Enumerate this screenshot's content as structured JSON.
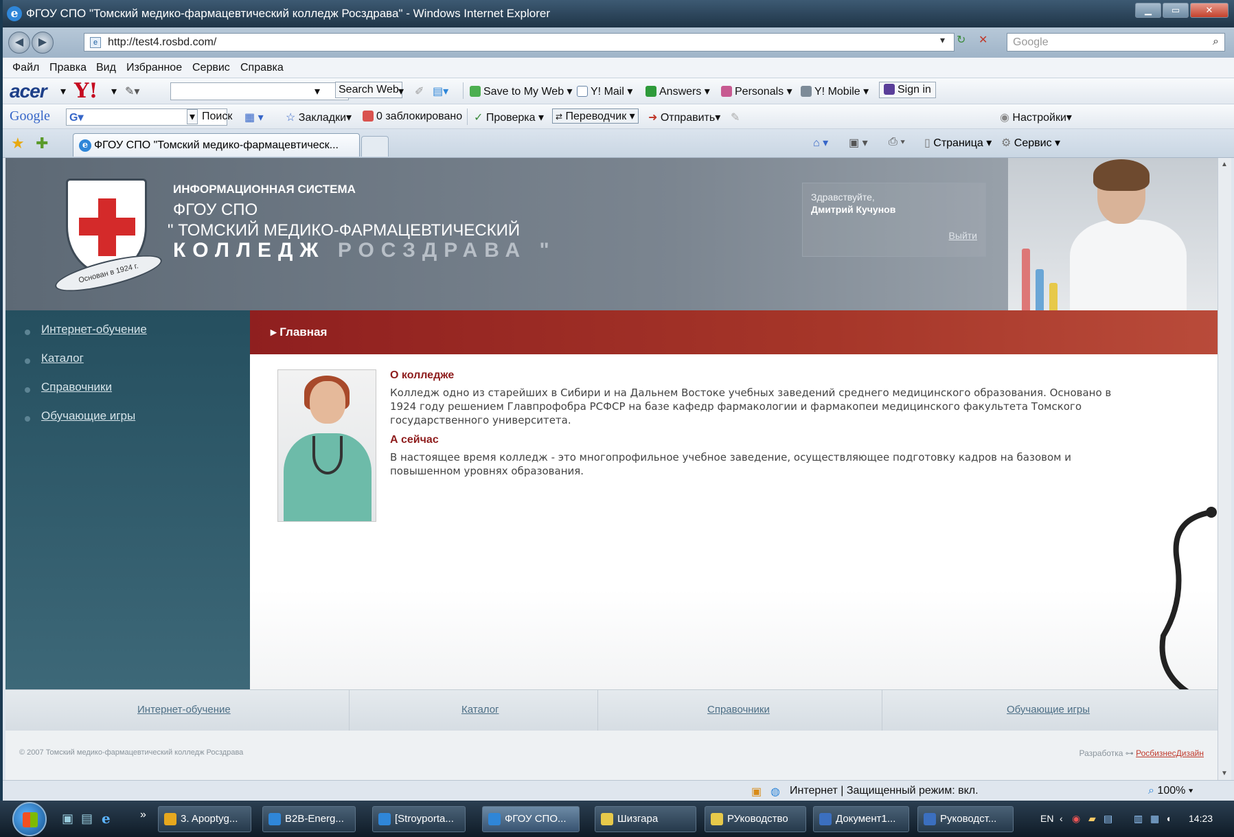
{
  "window": {
    "title": "ФГОУ СПО \"Томский медико-фармацевтический колледж Росздрава\" - Windows Internet Explorer",
    "address": "http://test4.rosbd.com/",
    "search_placeholder": "Google"
  },
  "menu": [
    "Файл",
    "Правка",
    "Вид",
    "Избранное",
    "Сервис",
    "Справка"
  ],
  "yahoo_toolbar": {
    "search_web": "Search Web",
    "save_to_my_web": "Save to My Web",
    "mail": "Y! Mail",
    "answers": "Answers",
    "personals": "Personals",
    "mobile": "Y! Mobile",
    "sign_in": "Sign in"
  },
  "google_toolbar": {
    "logo": "Google",
    "search": "Поиск",
    "bookmarks": "Закладки",
    "blocked": "0 заблокировано",
    "spellcheck": "Проверка",
    "translate": "Переводчик",
    "send": "Отправить",
    "settings": "Настройки"
  },
  "tabs": {
    "active_label": "ФГОУ СПО \"Томский медико-фармацевтическ...",
    "page_cmd": "Страница",
    "tools_cmd": "Сервис"
  },
  "banner": {
    "line1": "ИНФОРМАЦИОННАЯ СИСТЕМА",
    "line2": "ФГОУ СПО",
    "line3": "\" ТОМСКИЙ МЕДИКО-ФАРМАЦЕВТИЧЕСКИЙ",
    "line4a": "КОЛЛЕДЖ ",
    "line4b": "РОСЗДРАВА \"",
    "emblem_text": "Основан в 1924 г.",
    "greeting": "Здравствуйте,",
    "user_name": "Дмитрий Кучунов",
    "logout": "Выйти"
  },
  "sidebar": {
    "items": [
      "Интернет-обучение",
      "Каталог",
      "Справочники",
      "Обучающие игры"
    ]
  },
  "breadcrumb": "Главная",
  "content": {
    "about_title": "О колледже",
    "about_text": "Колледж одно из старейших в Сибири и на Дальнем Востоке учебных заведений среднего медицинского образования. Основано в 1924 году решением Главпрофобра РСФСР на базе кафедр фармакологии и фармакопеи медицинского факультета Томского государственного университета.",
    "now_title": "А сейчас",
    "now_text": "В настоящее время колледж - это многопрофильное учебное заведение, осуществляющее подготовку кадров на базовом и повышенном уровнях образования."
  },
  "footer": {
    "links": [
      "Интернет-обучение",
      "Каталог",
      "Справочники",
      "Обучающие игры"
    ],
    "copyright": "© 2007 Томский медико-фармацевтический колледж Росздрава",
    "dev_label": "Разработка",
    "dev_link": "РосбизнесДизайн"
  },
  "status": {
    "zone": "Интернет | Защищенный режим: вкл.",
    "zoom": "100%"
  },
  "taskbar": {
    "buttons": [
      "3. Apoptyg...",
      "B2B-Energ...",
      "[Stroyporta...",
      "ФГОУ СПО...",
      "Шизгара",
      "РУководство",
      "Документ1...",
      "Руководст..."
    ],
    "lang": "EN",
    "time": "14:23"
  },
  "colors": {
    "accent_red": "#8e1d1d",
    "sidebar_teal": "#254f5f",
    "link": "#4d6f86"
  }
}
